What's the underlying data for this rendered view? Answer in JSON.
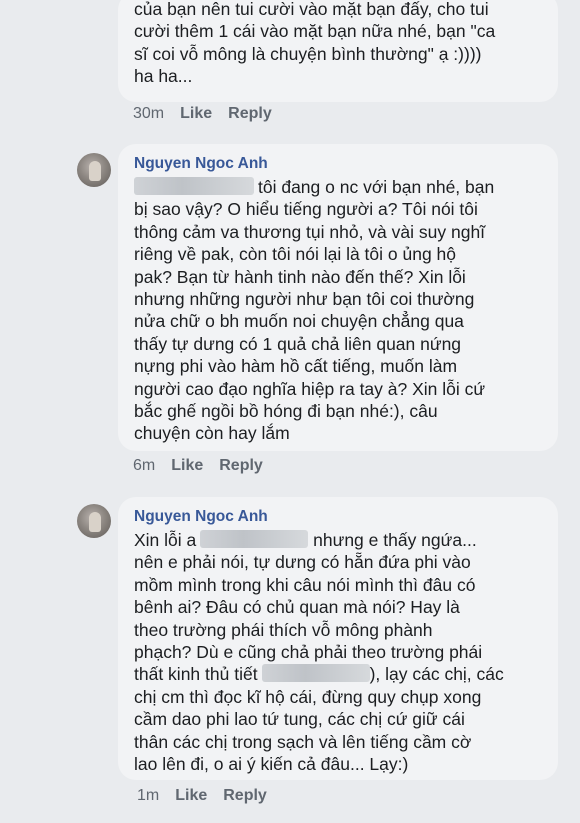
{
  "comments": [
    {
      "text": "của bạn nên tui cười vào mặt bạn đấy, cho tui\ncười thêm 1 cái vào mặt bạn nữa nhé, bạn \"ca\nsĩ  coi vỗ mông là chuyện bình thường\" ạ :))))\nha ha...",
      "time": "30m",
      "like": "Like",
      "reply": "Reply"
    },
    {
      "author": "Nguyen Ngoc Anh",
      "text_line1_after_blur": "tôi đang o nc với bạn nhé, bạn",
      "text_rest": "bị sao vậy? O hiểu tiếng người a? Tôi nói tôi\nthông cảm va thương tụi nhỏ, và vài suy nghĩ\nriêng về pak, còn tôi nói lại là tôi o ủng hộ\npak? Bạn từ hành tinh nào đến thế? Xin lỗi\nnhưng những người như bạn tôi coi thường\nnửa chữ o bh muốn noi chuyện chẳng qua\nthấy tự dưng có 1 quả chả liên quan nứng\nnựng phi vào hàm hồ cất tiếng, muốn làm\nngười cao đạo nghĩa hiệp ra tay à? Xin lỗi cứ\nbắc ghế ngồi bồ hóng đi bạn nhé:), câu\nchuyện còn hay lắm",
      "time": "6m",
      "like": "Like",
      "reply": "Reply"
    },
    {
      "author": "Nguyen Ngoc Anh",
      "line1_a": "Xin lỗi a",
      "line1_b": "nhưng e thấy ngứa...",
      "text_mid": "nên e phải nói, tự dưng có hẵn đứa phi vào\nmồm mình trong khi câu nói mình thì đâu có\nbênh ai? Đâu có chủ quan mà nói? Hay là\ntheo trường phái thích vỗ mông phành\nphạch? Dù e cũng chả phải theo trường phái",
      "line7_a": "thất kinh thủ tiết",
      "line7_b": "), lạy các chị, các",
      "text_end": "chị cm thì đọc kĩ hộ cái, đừng quy chụp xong\ncầm dao phi lao tứ tung, các chị cứ giữ cái\nthân các chị trong sạch và lên tiếng cầm cờ\nlao lên đi, o ai ý kiến cả đâu... Lạy:)",
      "time": "1m",
      "like": "Like",
      "reply": "Reply"
    }
  ]
}
